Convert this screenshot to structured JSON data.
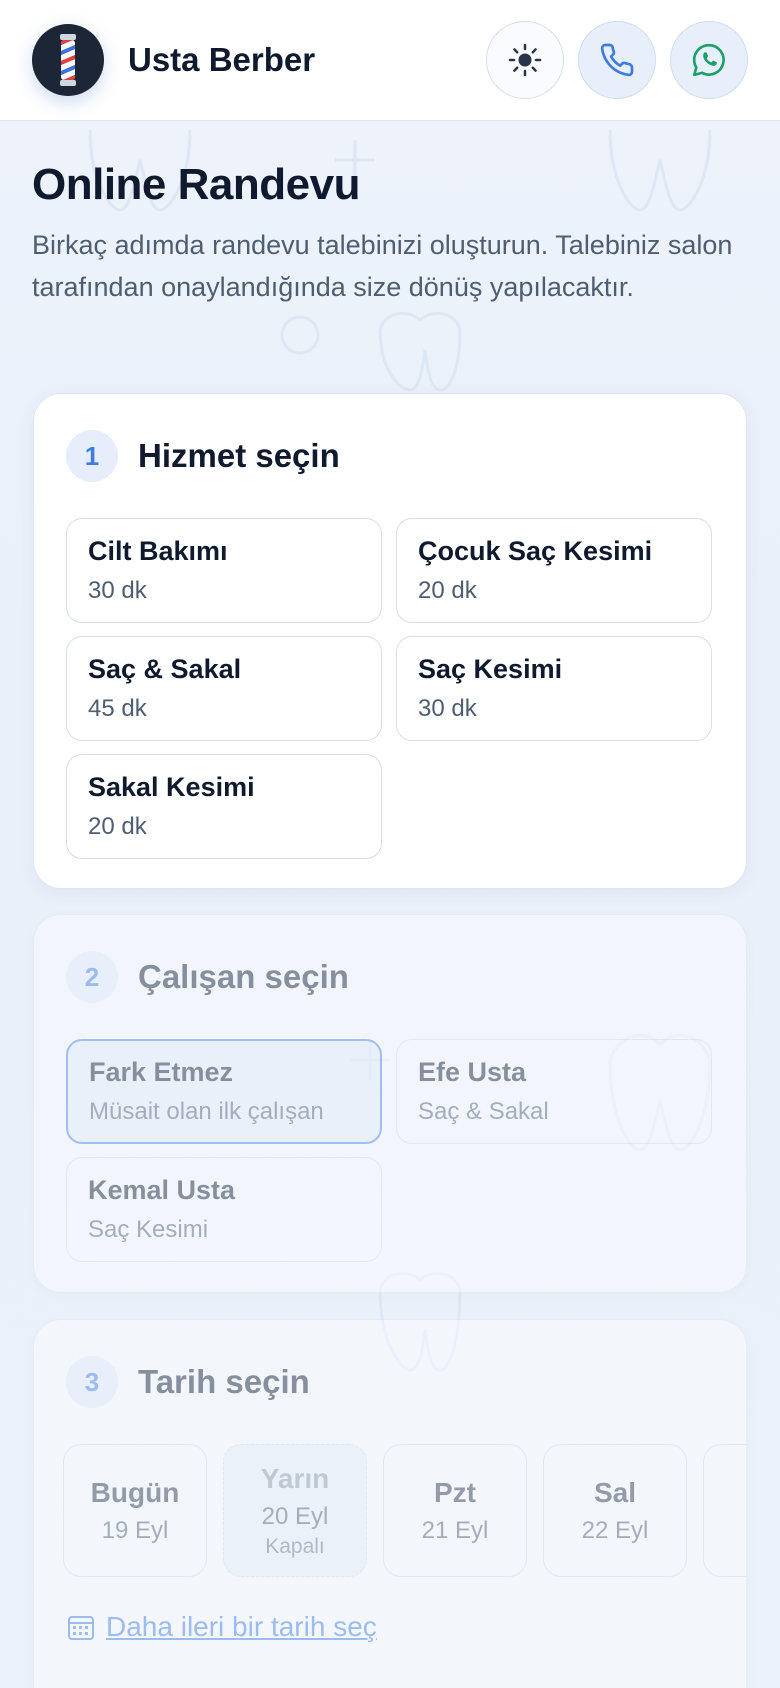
{
  "header": {
    "brand": "Usta Berber",
    "icons": {
      "logo": "barber-pole-icon",
      "theme": "sun-icon",
      "phone": "phone-icon",
      "whatsapp": "whatsapp-icon"
    },
    "colors": {
      "accent": "#3f7ce0",
      "whatsapp": "#1f9d6b"
    }
  },
  "intro": {
    "title": "Online Randevu",
    "description": "Birkaç adımda randevu talebinizi oluşturun. Talebiniz salon tarafından onaylandığında size dönüş yapılacaktır."
  },
  "steps": {
    "service": {
      "number": "1",
      "title": "Hizmet seçin",
      "options": [
        {
          "name": "Cilt Bakımı",
          "duration": "30 dk"
        },
        {
          "name": "Çocuk Saç Kesimi",
          "duration": "20 dk"
        },
        {
          "name": "Saç & Sakal",
          "duration": "45 dk"
        },
        {
          "name": "Saç Kesimi",
          "duration": "30 dk"
        },
        {
          "name": "Sakal Kesimi",
          "duration": "20 dk"
        }
      ]
    },
    "staff": {
      "number": "2",
      "title": "Çalışan seçin",
      "options": [
        {
          "name": "Fark Etmez",
          "detail": "Müsait olan ilk çalışan",
          "selected": true
        },
        {
          "name": "Efe Usta",
          "detail": "Saç & Sakal"
        },
        {
          "name": "Kemal Usta",
          "detail": "Saç Kesimi"
        }
      ]
    },
    "date": {
      "number": "3",
      "title": "Tarih seçin",
      "days": [
        {
          "day": "Bugün",
          "date": "19 Eyl"
        },
        {
          "day": "Yarın",
          "date": "20 Eyl",
          "note": "Kapalı"
        },
        {
          "day": "Pzt",
          "date": "21 Eyl"
        },
        {
          "day": "Sal",
          "date": "22 Eyl"
        }
      ],
      "more_link": "Daha ileri bir tarih seç"
    }
  }
}
